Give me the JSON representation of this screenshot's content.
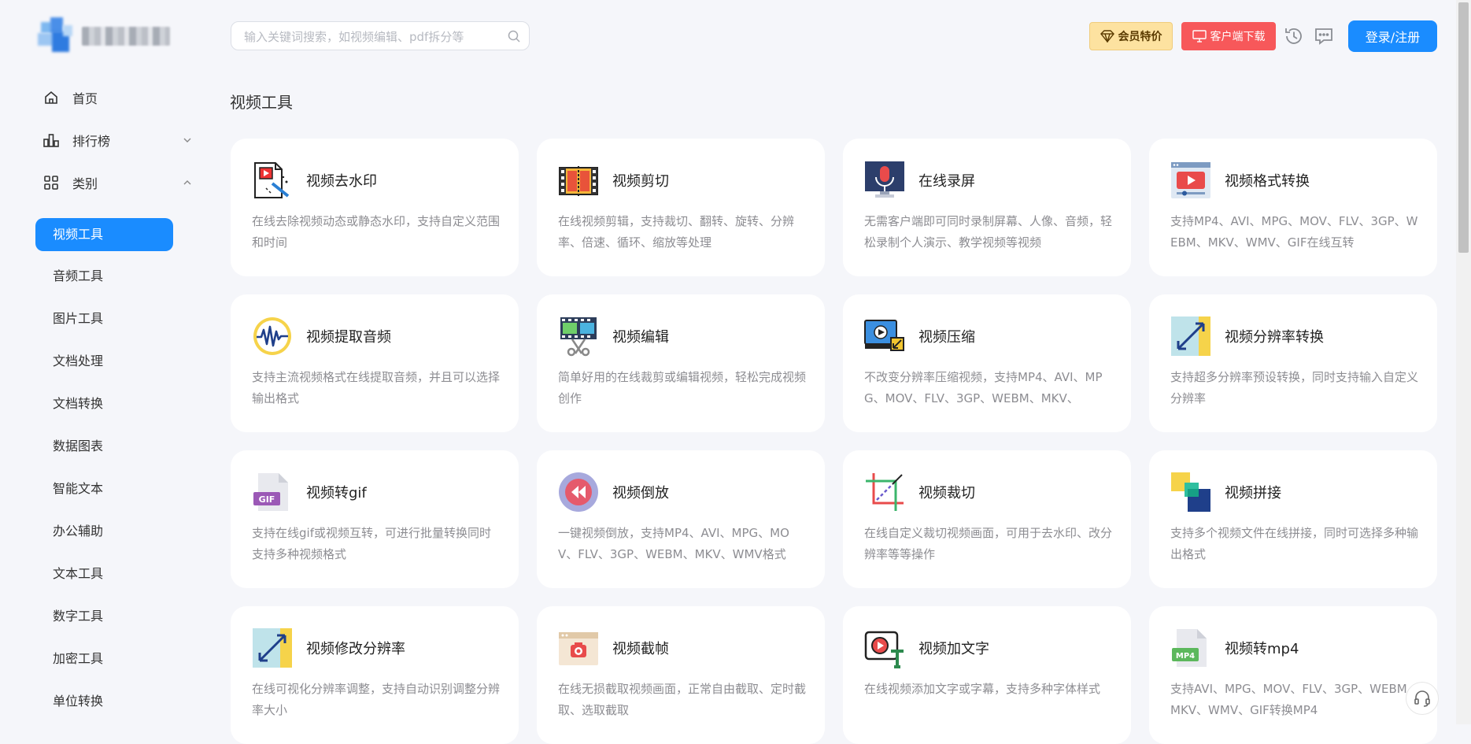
{
  "header": {
    "search_placeholder": "输入关键词搜索，如视频编辑、pdf拆分等",
    "vip_label": "会员特价",
    "download_label": "客户端下载",
    "login_label": "登录/注册"
  },
  "sidebar": {
    "top": [
      {
        "label": "首页",
        "icon": "home-icon"
      },
      {
        "label": "排行榜",
        "icon": "bar-chart-icon"
      },
      {
        "label": "类别",
        "icon": "grid-icon"
      }
    ],
    "categories": [
      "视频工具",
      "音频工具",
      "图片工具",
      "文档处理",
      "文档转换",
      "数据图表",
      "智能文本",
      "办公辅助",
      "文本工具",
      "数字工具",
      "加密工具",
      "单位转换"
    ],
    "active_category": "视频工具"
  },
  "main": {
    "section_title": "视频工具",
    "cards": [
      {
        "title": "视频去水印",
        "desc": "在线去除视频动态或静态水印，支持自定义范围和时间",
        "icon": "watermark-remove-icon"
      },
      {
        "title": "视频剪切",
        "desc": "在线视频剪辑，支持裁切、翻转、旋转、分辨率、倍速、循环、缩放等处理",
        "icon": "film-cut-icon"
      },
      {
        "title": "在线录屏",
        "desc": "无需客户端即可同时录制屏幕、人像、音频，轻松录制个人演示、教学视频等视频",
        "icon": "screen-record-icon"
      },
      {
        "title": "视频格式转换",
        "desc": "支持MP4、AVI、MPG、MOV、FLV、3GP、WEBM、MKV、WMV、GIF在线互转",
        "icon": "video-format-icon"
      },
      {
        "title": "视频提取音频",
        "desc": "支持主流视频格式在线提取音频，并且可以选择输出格式",
        "icon": "audio-extract-icon"
      },
      {
        "title": "视频编辑",
        "desc": "简单好用的在线裁剪或编辑视频，轻松完成视频创作",
        "icon": "video-edit-icon"
      },
      {
        "title": "视频压缩",
        "desc": "不改变分辨率压缩视频，支持MP4、AVI、MPG、MOV、FLV、3GP、WEBM、MKV、",
        "icon": "video-compress-icon"
      },
      {
        "title": "视频分辨率转换",
        "desc": "支持超多分辨率预设转换，同时支持输入自定义分辨率",
        "icon": "resolution-icon"
      },
      {
        "title": "视频转gif",
        "desc": "支持在线gif或视频互转，可进行批量转换同时支持多种视频格式",
        "icon": "gif-file-icon"
      },
      {
        "title": "视频倒放",
        "desc": "一键视频倒放，支持MP4、AVI、MPG、MOV、FLV、3GP、WEBM、MKV、WMV格式",
        "icon": "rewind-icon"
      },
      {
        "title": "视频裁切",
        "desc": "在线自定义裁切视频画面，可用于去水印、改分辨率等等操作",
        "icon": "crop-icon"
      },
      {
        "title": "视频拼接",
        "desc": "支持多个视频文件在线拼接，同时可选择多种输出格式",
        "icon": "merge-icon"
      },
      {
        "title": "视频修改分辨率",
        "desc": "在线可视化分辨率调整，支持自动识别调整分辨率大小",
        "icon": "resize-icon"
      },
      {
        "title": "视频截帧",
        "desc": "在线无损截取视频画面，正常自由截取、定时截取、选取截取",
        "icon": "frame-capture-icon"
      },
      {
        "title": "视频加文字",
        "desc": "在线视频添加文字或字幕，支持多种字体样式",
        "icon": "add-text-icon"
      },
      {
        "title": "视频转mp4",
        "desc": "支持AVI、MPG、MOV、FLV、3GP、WEBM、MKV、WMV、GIF转换MP4",
        "icon": "mp4-file-icon"
      }
    ]
  },
  "colors": {
    "accent": "#1a8cff",
    "vip_bg": "#fde2a0",
    "download_bg": "#f7585a",
    "page_bg": "#f5f6fa"
  }
}
